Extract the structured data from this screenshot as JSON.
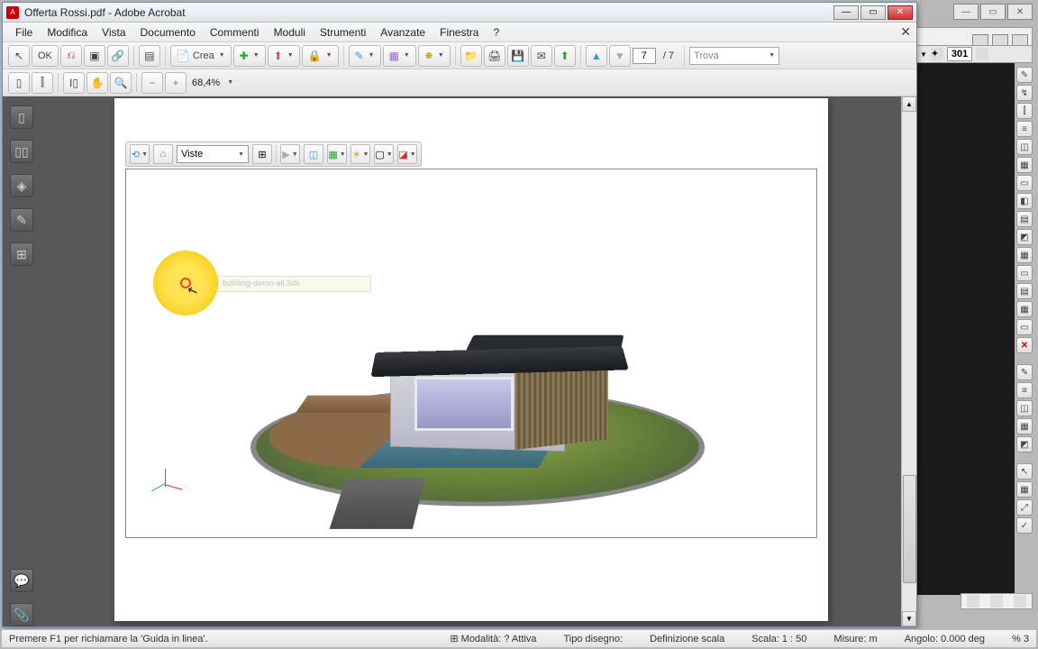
{
  "bg_app": {
    "number_field": "301",
    "status": {
      "help": "Premere F1 per richiamare la 'Guida in linea'.",
      "modalita_label": "Modalità:",
      "modalita_value": "? Attiva",
      "tipo_label": "Tipo disegno:",
      "scala_def": "Definizione scala",
      "scala_label": "Scala:",
      "scala_value": "1 : 50",
      "misure_label": "Misure:",
      "misure_value": "m",
      "angolo_label": "Angolo:",
      "angolo_value": "0.000",
      "deg_label": "deg",
      "pct_label": "%",
      "pct_value": "3"
    }
  },
  "acrobat": {
    "title": "Offerta Rossi.pdf - Adobe Acrobat",
    "menu": [
      "File",
      "Modifica",
      "Vista",
      "Documento",
      "Commenti",
      "Moduli",
      "Strumenti",
      "Avanzate",
      "Finestra",
      "?"
    ],
    "toolbar": {
      "ok": "OK",
      "crea": "Crea",
      "page_current": "7",
      "page_total": "/ 7",
      "find_placeholder": "Trova"
    },
    "zoom": "68,4%",
    "viewer3d": {
      "views_label": "Viste"
    },
    "highlight_hint": "building-demo-all.3ds"
  }
}
